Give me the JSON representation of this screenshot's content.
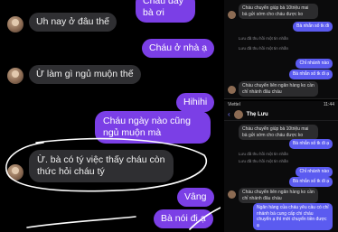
{
  "left_chat": {
    "top_partial": "Cháu đây bà ơi",
    "messages": [
      {
        "side": "in",
        "text": "Uh nay ở đâu thế"
      },
      {
        "side": "out",
        "text": "Cháu ở nhà ạ"
      },
      {
        "side": "in",
        "text": "Ừ làm gì ngủ muộn thế"
      },
      {
        "side": "out",
        "text": "Hihihi"
      },
      {
        "side": "out",
        "text": "Cháu ngày nào cũng ngủ muộn mà"
      },
      {
        "side": "in",
        "text": "Ừ. bà có tý việc thấy cháu còn thức hỏi cháu tý"
      },
      {
        "side": "out",
        "text": "Vâng"
      },
      {
        "side": "out",
        "text": "Bà nói đi ạ"
      }
    ]
  },
  "shot_top": {
    "messages": [
      {
        "side": "in",
        "text": "Cháu chuyển giúp bà 10triệu mai bà gửi sớm cho cháu được ko"
      },
      {
        "side": "out",
        "text": "Bà nhắn số tk đi"
      },
      {
        "side": "note",
        "text": "Lưu đã thu hồi một tin nhắn"
      },
      {
        "side": "note",
        "text": "Lưu đã thu hồi một tin nhắn"
      },
      {
        "side": "out",
        "text": "Chỉ nhánh nào"
      },
      {
        "side": "out",
        "text": "Bà nhắn số tk đi ạ"
      },
      {
        "side": "in",
        "text": "Cháu chuyển liên ngân hàng ko cần chỉ nhánh đâu cháu"
      }
    ]
  },
  "shot_bottom": {
    "status_carrier": "Viettel",
    "status_time": "11:44",
    "contact_name": "Thẹ Lưu",
    "back_glyph": "‹",
    "messages": [
      {
        "side": "in",
        "text": "Cháu chuyển giúp bà 10triệu mai bà gửi sớm cho cháu được ko"
      },
      {
        "side": "out",
        "text": "Bà nhắn số tk đi ạ"
      },
      {
        "side": "note",
        "text": "Lưu đã thu hồi một tin nhắn"
      },
      {
        "side": "note",
        "text": "Lưu đã thu hồi một tin nhắn"
      },
      {
        "side": "out",
        "text": "Chỉ nhánh nào"
      },
      {
        "side": "out",
        "text": "Bà nhắn số tk đi ạ"
      },
      {
        "side": "in",
        "text": "Cháu chuyển liên ngân hàng ko cần chỉ nhánh đâu cháu"
      },
      {
        "side": "out",
        "text": "Ngân hàng của cháu yêu cầu có chỉ nhánh bà cung cấp chi cháu chuyển ạ thì mới chuyển tiền được ạ"
      }
    ]
  },
  "colors": {
    "outgoing": "#7b3fe6",
    "incoming": "#2f2f32",
    "background": "#000000",
    "shot_outgoing": "#5b5bf0"
  }
}
